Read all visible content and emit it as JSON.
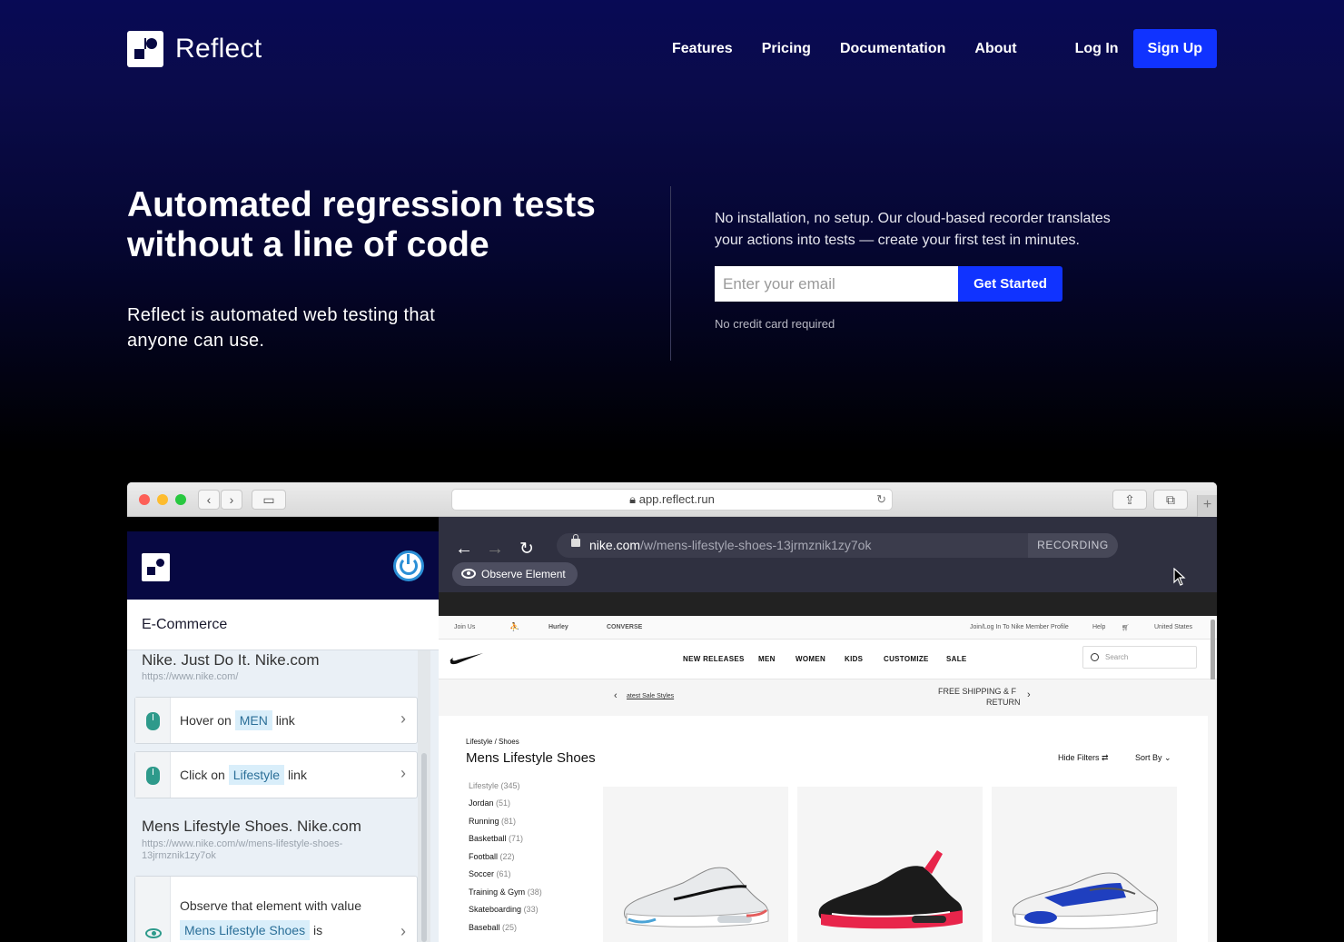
{
  "brand": {
    "name": "Reflect"
  },
  "nav": {
    "links": [
      "Features",
      "Pricing",
      "Documentation",
      "About"
    ],
    "login": "Log In",
    "signup": "Sign Up"
  },
  "hero": {
    "title": "Automated regression tests without a line of code",
    "subtitle": "Reflect is automated web testing that anyone can use.",
    "description": "No installation, no setup. Our cloud-based recorder translates your actions into tests — create your first test in minutes.",
    "email_placeholder": "Enter your email",
    "cta": "Get Started",
    "note": "No credit card required"
  },
  "browser": {
    "address": "app.reflect.run"
  },
  "reflect_app": {
    "suite": "E-Commerce",
    "page1": {
      "title": "Nike. Just Do It. Nike.com",
      "url": "https://www.nike.com/"
    },
    "step1": {
      "prefix": "Hover on",
      "target": "MEN",
      "suffix": "link"
    },
    "step2": {
      "prefix": "Click on",
      "target": "Lifestyle",
      "suffix": "link"
    },
    "page2": {
      "title": "Mens Lifestyle Shoes. Nike.com",
      "url": "https://www.nike.com/w/mens-lifestyle-shoes-13jrmznik1zy7ok"
    },
    "step3": {
      "prefix": "Observe that element with value",
      "target": "Mens Lifestyle Shoes",
      "suffix": "is"
    }
  },
  "recorder": {
    "host": "nike.com",
    "path": "/w/mens-lifestyle-shoes-13jrmznik1zy7ok",
    "badge": "RECORDING",
    "observe": "Observe Element"
  },
  "nike": {
    "top_links": [
      "Join Us",
      "Hurley",
      "CONVERSE"
    ],
    "top_right": [
      "Join/Log In To Nike Member Profile",
      "Help",
      "United States"
    ],
    "nav": [
      "NEW RELEASES",
      "MEN",
      "WOMEN",
      "KIDS",
      "CUSTOMIZE",
      "SALE"
    ],
    "search_placeholder": "Search",
    "promo_left": "atest Sale Styles",
    "promo_right_1": "FREE SHIPPING & F",
    "promo_right_2": "RETURN",
    "breadcrumb": "Lifestyle / Shoes",
    "heading": "Mens Lifestyle Shoes",
    "hide_filters": "Hide Filters",
    "sort_by": "Sort By",
    "categories": [
      {
        "name": "Lifestyle",
        "count": "(345)"
      },
      {
        "name": "Jordan",
        "count": "(51)"
      },
      {
        "name": "Running",
        "count": "(81)"
      },
      {
        "name": "Basketball",
        "count": "(71)"
      },
      {
        "name": "Football",
        "count": "(22)"
      },
      {
        "name": "Soccer",
        "count": "(61)"
      },
      {
        "name": "Training & Gym",
        "count": "(38)"
      },
      {
        "name": "Skateboarding",
        "count": "(33)"
      },
      {
        "name": "Baseball",
        "count": "(25)"
      }
    ]
  },
  "colors": {
    "primary_blue": "#1033ff",
    "navy": "#070842",
    "teal": "#2e9a8b"
  }
}
